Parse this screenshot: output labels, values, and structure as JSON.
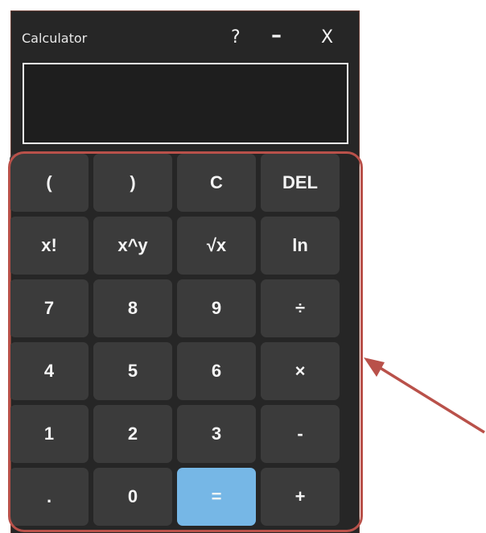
{
  "window": {
    "title": "Calculator",
    "controls": {
      "help": "?",
      "minimize": "–",
      "close": "X"
    }
  },
  "display": {
    "value": ""
  },
  "keypad": {
    "keys": [
      "(",
      ")",
      "C",
      "DEL",
      "x!",
      "x^y",
      "√x",
      "ln",
      "7",
      "8",
      "9",
      "÷",
      "4",
      "5",
      "6",
      "×",
      "1",
      "2",
      "3",
      "-",
      ".",
      "0",
      "=",
      "+"
    ]
  },
  "colors": {
    "window_bg": "#262626",
    "key_bg": "#3b3b3b",
    "equals_key_bg": "#76b7e6",
    "annotation": "#b9514a"
  }
}
